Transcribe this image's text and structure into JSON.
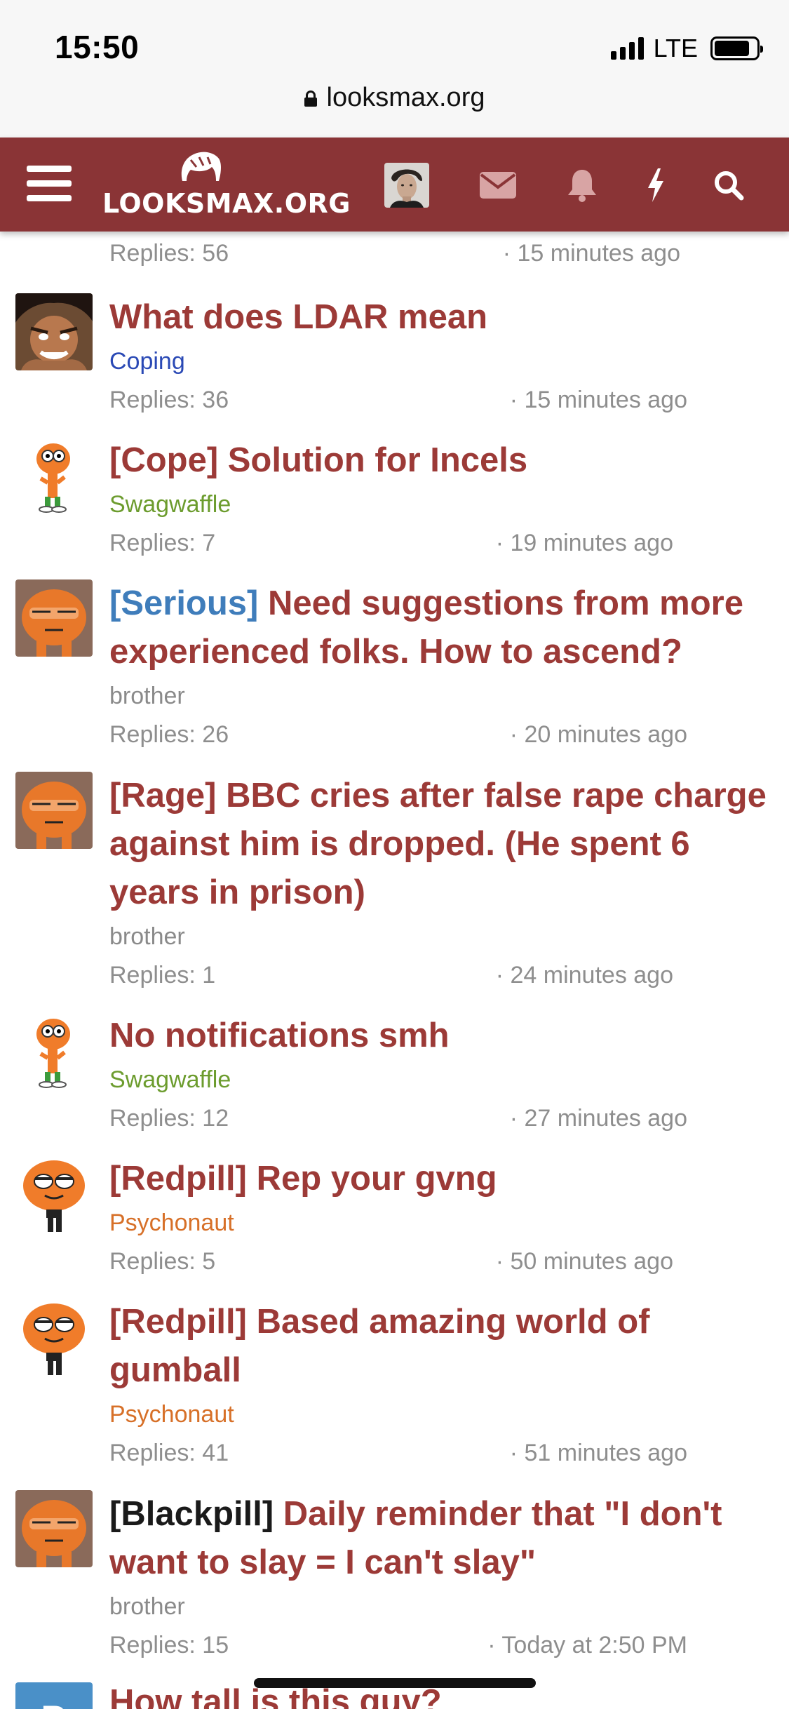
{
  "status_bar": {
    "time": "15:50",
    "network": "LTE",
    "battery_level": 0.85,
    "signal_bars": 4
  },
  "browser": {
    "url": "looksmax.org"
  },
  "site_header": {
    "logo_text": "LOOKSMAX.ORG",
    "brand_color": "#8a3436",
    "icons": [
      "menu-icon",
      "user-avatar",
      "mail-icon",
      "bell-icon",
      "bolt-icon",
      "search-icon"
    ]
  },
  "partial_item": {
    "replies": "Replies: 56",
    "time": "· 15 minutes ago"
  },
  "threads": [
    {
      "prefix": "",
      "title": "What does LDAR mean",
      "author": "Coping",
      "replies": "Replies: 36",
      "time": "· 15 minutes ago"
    },
    {
      "prefix": "",
      "title": "[Cope] Solution for Incels",
      "author": "Swagwaffle",
      "replies": "Replies: 7",
      "time": "· 19 minutes ago"
    },
    {
      "prefix": "[Serious]",
      "title": "Need suggestions from more experienced folks. How to ascend?",
      "author": "brother",
      "replies": "Replies: 26",
      "time": "· 20 minutes ago"
    },
    {
      "prefix": "",
      "title": "[Rage] BBC cries after false rape charge against him is dropped. (He spent 6 years in prison)",
      "author": "brother",
      "replies": "Replies: 1",
      "time": "· 24 minutes ago"
    },
    {
      "prefix": "",
      "title": "No notifications smh",
      "author": "Swagwaffle",
      "replies": "Replies: 12",
      "time": "· 27 minutes ago"
    },
    {
      "prefix": "",
      "title": "[Redpill] Rep your gvng",
      "author": "Psychonaut",
      "replies": "Replies: 5",
      "time": "· 50 minutes ago"
    },
    {
      "prefix": "",
      "title": "[Redpill] Based amazing world of gumball",
      "author": "Psychonaut",
      "replies": "Replies: 41",
      "time": "· 51 minutes ago"
    },
    {
      "prefix": "[Blackpill]",
      "title": "Daily reminder that \"I don't want to slay = I can't slay\"",
      "author": "brother",
      "replies": "Replies: 15",
      "time": "· Today at 2:50 PM"
    },
    {
      "prefix": "",
      "title": "How tall is this guy?",
      "avatar_letter": "B"
    }
  ]
}
